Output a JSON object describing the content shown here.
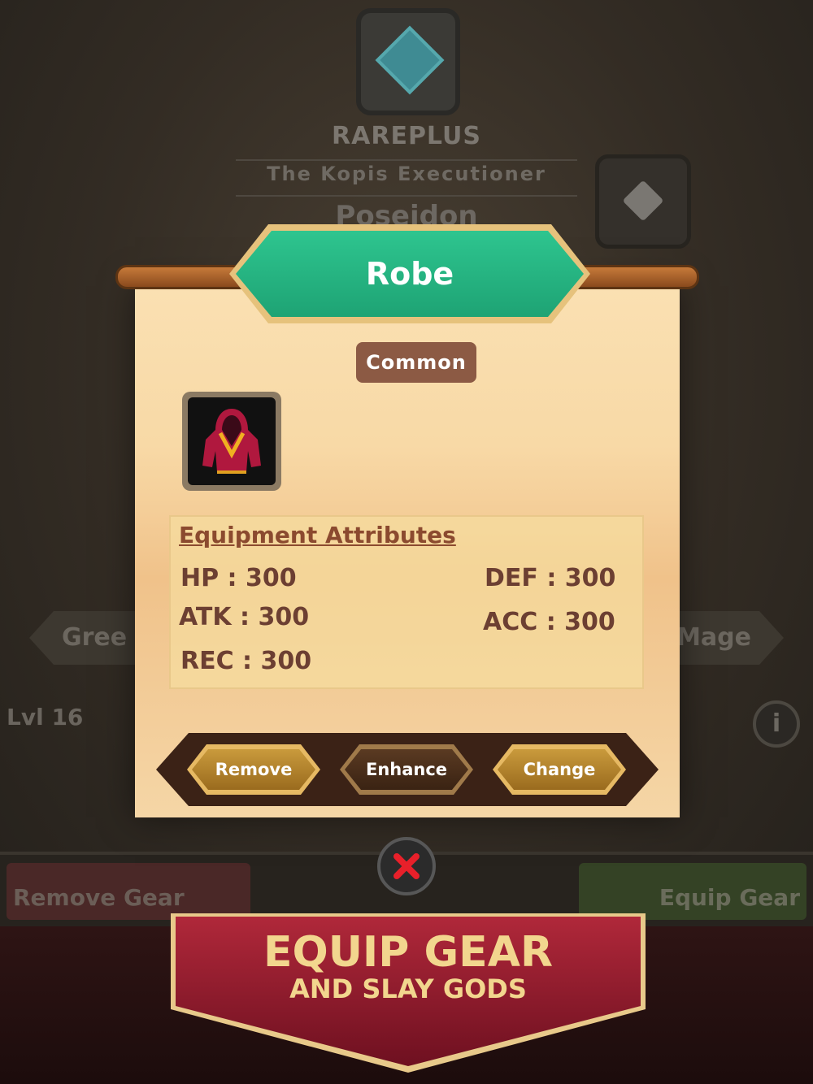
{
  "background": {
    "rarity_label": "RAREPLUS",
    "item_name": "The Kopis Executioner",
    "god_name": "Poseidon",
    "left_tag": "Gree",
    "right_tag": "Mage",
    "level": "Lvl 16",
    "info_icon": "i",
    "remove_gear_label": "Remove Gear",
    "equip_gear_label": "Equip Gear"
  },
  "modal": {
    "title": "Robe",
    "rarity": "Common",
    "item_icon": "robe-icon",
    "attributes_title": "Equipment Attributes",
    "attributes": {
      "hp": "HP : 300",
      "atk": "ATK : 300",
      "rec": "REC : 300",
      "def": "DEF :  300",
      "acc": "ACC : 300"
    },
    "buttons": {
      "remove": "Remove",
      "enhance": "Enhance",
      "change": "Change"
    },
    "close_icon": "close-icon"
  },
  "promo": {
    "line1": "EQUIP GEAR",
    "line2": "AND SLAY GODS"
  },
  "colors": {
    "title_green": "#1ea374",
    "rarity_badge": "#8c5a44",
    "attr_text": "#6c3f32",
    "promo_gold": "#f2d68e",
    "promo_red": "#8e1a2c"
  }
}
